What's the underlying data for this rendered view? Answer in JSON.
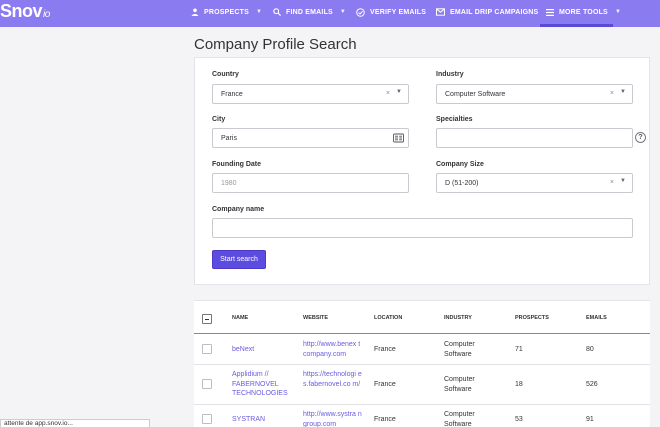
{
  "app": {
    "logo_text": "Snov",
    "logo_suffix": "io"
  },
  "nav": {
    "prospects": "PROSPECTS",
    "find_emails": "FIND EMAILS",
    "verify_emails": "VERIFY EMAILS",
    "email_drip": "EMAIL DRIP CAMPAIGNS",
    "more_tools": "MORE TOOLS"
  },
  "page": {
    "title": "Company Profile Search"
  },
  "form": {
    "country_label": "Country",
    "country_value": "France",
    "industry_label": "Industry",
    "industry_value": "Computer Software",
    "city_label": "City",
    "city_value": "Paris",
    "specialties_label": "Specialties",
    "specialties_value": "",
    "specialties_help": "?",
    "founding_label": "Founding Date",
    "founding_placeholder": "1980",
    "size_label": "Company Size",
    "size_value": "D (51-200)",
    "name_label": "Company name",
    "name_value": "",
    "clear_glyph": "×",
    "start_button": "Start search"
  },
  "table": {
    "headers": {
      "name": "NAME",
      "website": "WEBSITE",
      "location": "LOCATION",
      "industry": "INDUSTRY",
      "prospects": "PROSPECTS",
      "emails": "EMAILS"
    },
    "rows": [
      {
        "name": "beNext",
        "website": "http://www.benex tcompany.com",
        "location": "France",
        "industry": "Computer Software",
        "prospects": "71",
        "emails": "80"
      },
      {
        "name": "Applidium // FABERNOVEL TECHNOLOGIES",
        "website": "https://technologi es.fabernovel.co m/",
        "location": "France",
        "industry": "Computer Software",
        "prospects": "18",
        "emails": "526"
      },
      {
        "name": "SYSTRAN",
        "website": "http://www.systra ngroup.com",
        "location": "France",
        "industry": "Computer Software",
        "prospects": "53",
        "emails": "91"
      }
    ]
  },
  "status": {
    "text": "attente de app.snov.io..."
  },
  "colors": {
    "brand": "#8b7bf0",
    "button": "#5c4de0",
    "link": "#6a5ce0"
  }
}
